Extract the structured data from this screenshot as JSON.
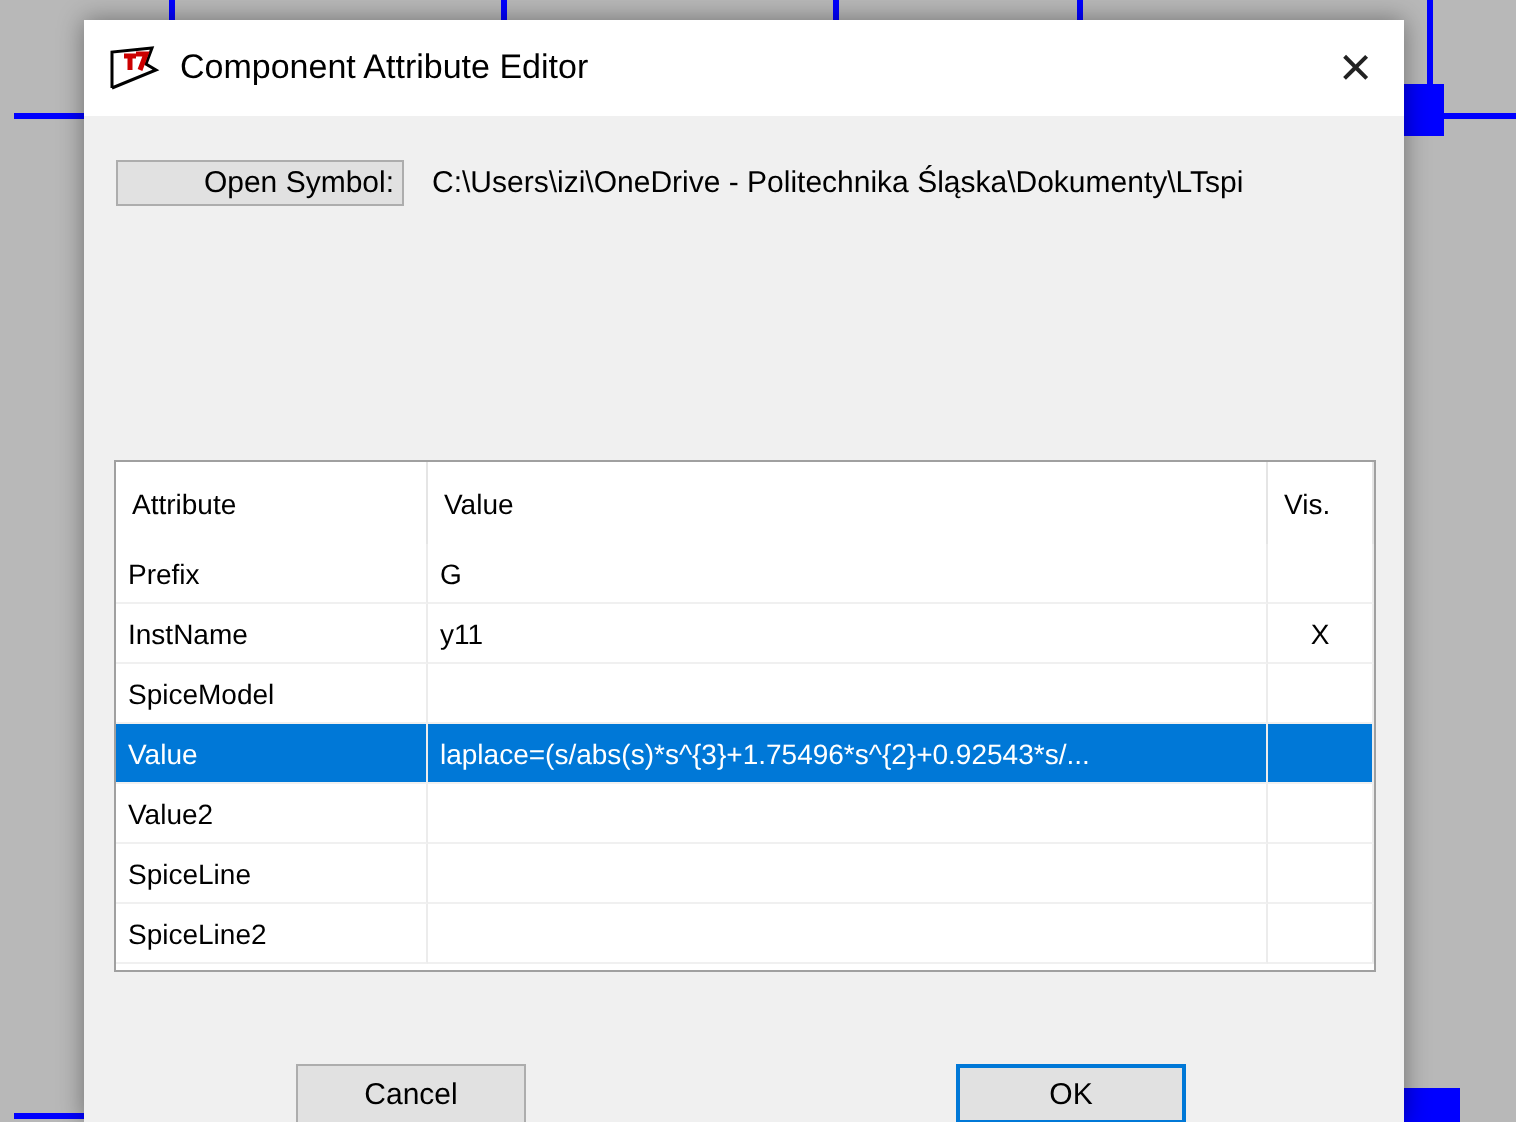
{
  "window": {
    "title": "Component Attribute Editor",
    "close": "×"
  },
  "symbol": {
    "button": "Open Symbol:",
    "path": "C:\\Users\\izi\\OneDrive - Politechnika Śląska\\Dokumenty\\LTspi"
  },
  "table": {
    "columns": [
      "Attribute",
      "Value",
      "Vis."
    ],
    "rows": [
      {
        "attribute": "Prefix",
        "value": "G",
        "vis": "",
        "selected": false
      },
      {
        "attribute": "InstName",
        "value": "y11",
        "vis": "X",
        "selected": false
      },
      {
        "attribute": "SpiceModel",
        "value": "",
        "vis": "",
        "selected": false
      },
      {
        "attribute": "Value",
        "value": "laplace=(s/abs(s)*s^{3}+1.75496*s^{2}+0.92543*s/...",
        "vis": "",
        "selected": true
      },
      {
        "attribute": "Value2",
        "value": "",
        "vis": "",
        "selected": false
      },
      {
        "attribute": "SpiceLine",
        "value": "",
        "vis": "",
        "selected": false
      },
      {
        "attribute": "SpiceLine2",
        "value": "",
        "vis": "",
        "selected": false
      }
    ]
  },
  "buttons": [
    {
      "label": "Cancel",
      "default": false
    },
    {
      "label": "OK",
      "default": true
    }
  ]
}
